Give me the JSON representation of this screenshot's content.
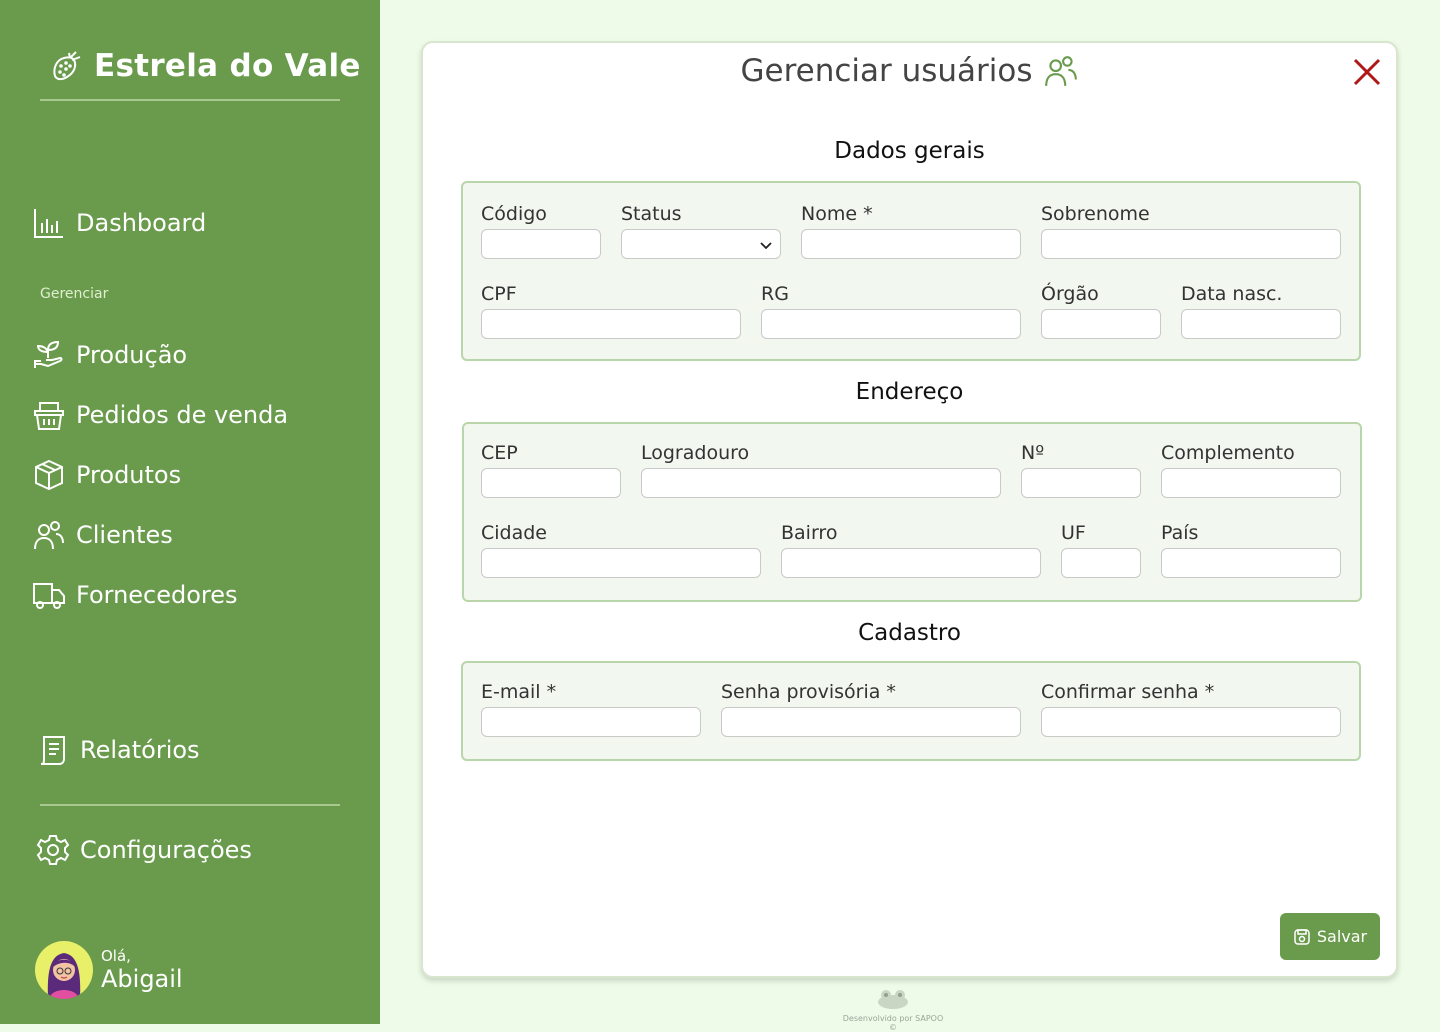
{
  "app": {
    "brand": "Estrela do Vale"
  },
  "sidebar": {
    "dashboard": "Dashboard",
    "section_label": "Gerenciar",
    "items": [
      {
        "label": "Produção",
        "icon": "plant-hand-icon"
      },
      {
        "label": "Pedidos de venda",
        "icon": "basket-icon"
      },
      {
        "label": "Produtos",
        "icon": "box-icon"
      },
      {
        "label": "Clientes",
        "icon": "users-icon"
      },
      {
        "label": "Fornecedores",
        "icon": "truck-icon"
      }
    ],
    "reports": "Relatórios",
    "settings": "Configurações"
  },
  "user": {
    "greeting": "Olá,",
    "name": "Abigail"
  },
  "modal": {
    "title": "Gerenciar usuários",
    "sections": {
      "general": "Dados gerais",
      "address": "Endereço",
      "registration": "Cadastro"
    },
    "fields": {
      "codigo": "Código",
      "status": "Status",
      "nome": "Nome *",
      "sobrenome": "Sobrenome",
      "cpf": "CPF",
      "rg": "RG",
      "orgao": "Órgão",
      "data_nasc": "Data nasc.",
      "cep": "CEP",
      "logradouro": "Logradouro",
      "numero": "Nº",
      "complemento": "Complemento",
      "cidade": "Cidade",
      "bairro": "Bairro",
      "uf": "UF",
      "pais": "País",
      "email": "E-mail *",
      "senha": "Senha provisória *",
      "confirmar": "Confirmar senha *"
    },
    "save": "Salvar"
  },
  "footer": {
    "credit": "Desenvolvido por SAPOO ©"
  },
  "colors": {
    "sidebar": "#6a9b4d",
    "background": "#eefbe8",
    "close": "#b01818"
  }
}
